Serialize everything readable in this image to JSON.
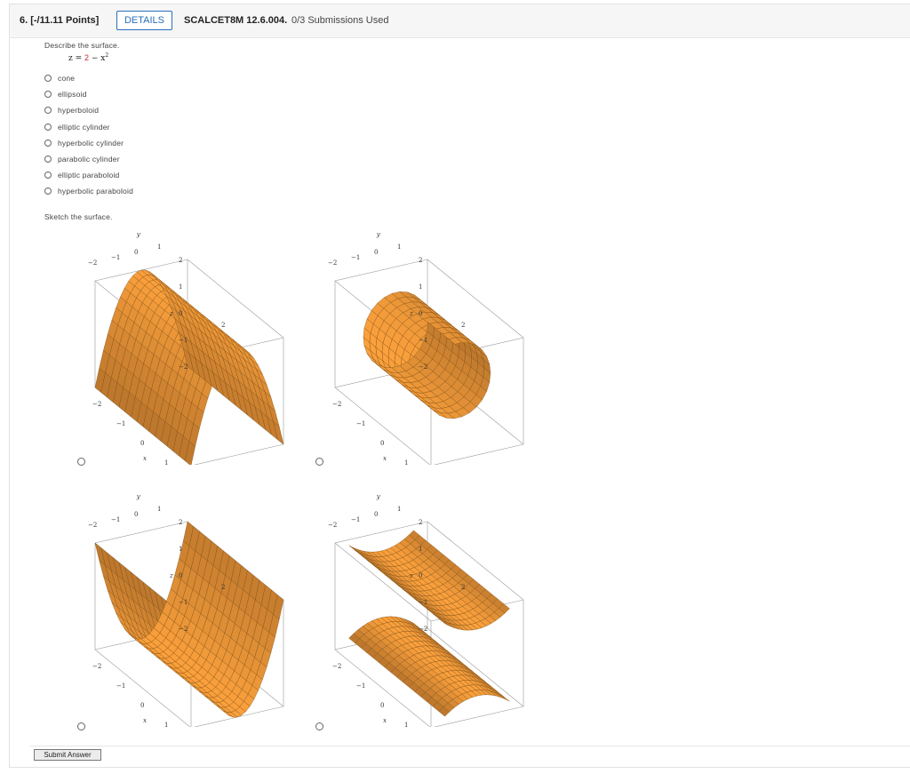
{
  "question": {
    "number": "6. [-/11.11 Points]",
    "details_label": "DETAILS",
    "code": "SCALCET8M 12.6.004.",
    "submissions": "0/3 Submissions Used"
  },
  "part1": {
    "prompt": "Describe the surface.",
    "equation": {
      "lhs": "z =",
      "const": "2",
      "rest": " − x",
      "exp": "2"
    },
    "options": [
      "cone",
      "ellipsoid",
      "hyperboloid",
      "elliptic cylinder",
      "hyperbolic cylinder",
      "parabolic cylinder",
      "elliptic paraboloid",
      "hyperbolic paraboloid"
    ]
  },
  "part2": {
    "prompt": "Sketch the surface.",
    "axis_labels": {
      "x": "x",
      "y": "y",
      "z": "z"
    },
    "ticks": {
      "neg2": "−2",
      "neg1": "−1",
      "zero": "0",
      "one": "1",
      "two": "2"
    },
    "plots": [
      {
        "id": "downward-parabolic-cylinder"
      },
      {
        "id": "circular-cylinder"
      },
      {
        "id": "upward-parabolic-cylinder"
      },
      {
        "id": "two-sheet-surface"
      }
    ]
  },
  "colors": {
    "surface": "#f0a040",
    "surface_dark": "#d87a1e",
    "mesh": "#7a4a10",
    "link": "#2a6ebb"
  },
  "submit_label": "Submit Answer"
}
